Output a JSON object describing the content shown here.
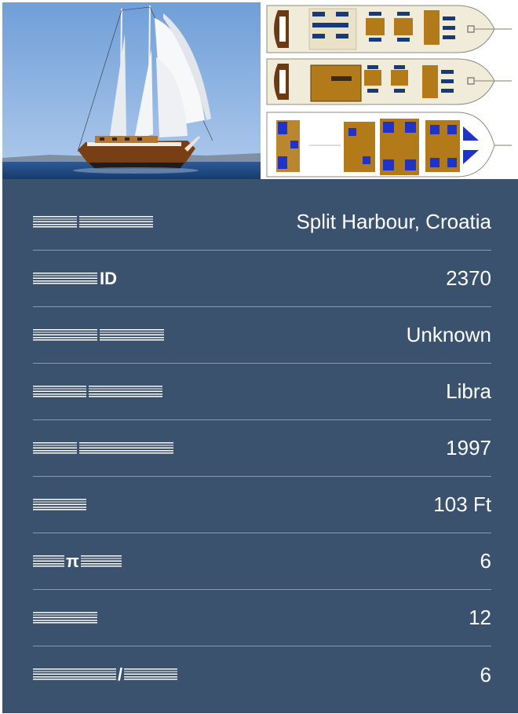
{
  "colors": {
    "panel_background": "#3a526d",
    "divider": "#8a9aab",
    "text": "#ffffff"
  },
  "gallery": {
    "photo_icon": "sailing-yacht-photo",
    "plans_icon": "deck-plan-drawing"
  },
  "specs": [
    {
      "label_text": "",
      "value": "Split Harbour, Croatia"
    },
    {
      "label_text": "ID",
      "value": "2370"
    },
    {
      "label_text": "",
      "value": "Unknown"
    },
    {
      "label_text": "",
      "value": "Libra"
    },
    {
      "label_text": "",
      "value": "1997"
    },
    {
      "label_text": "",
      "value": "103 Ft"
    },
    {
      "label_text": "π",
      "value": "6"
    },
    {
      "label_text": "",
      "value": "12"
    },
    {
      "label_text": "/",
      "value": "6"
    }
  ]
}
